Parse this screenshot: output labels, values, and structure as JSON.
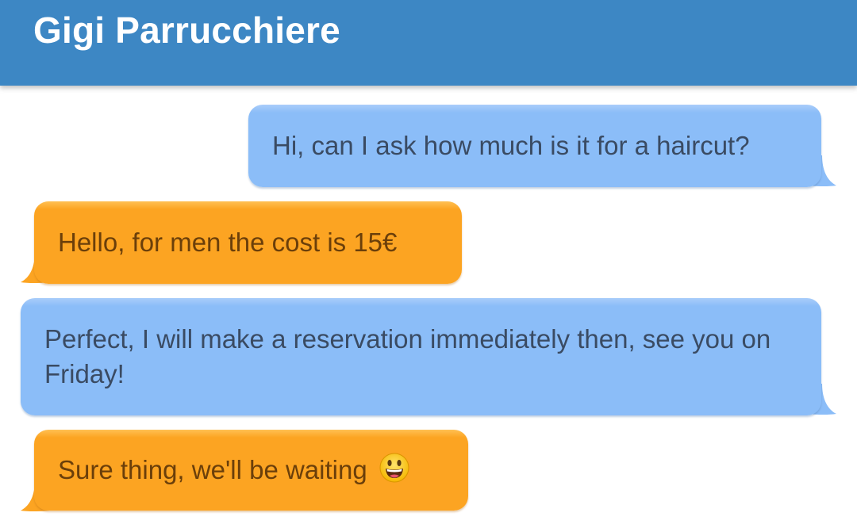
{
  "header": {
    "title": "Gigi Parrucchiere"
  },
  "messages": [
    {
      "direction": "outgoing",
      "text": "Hi, can I ask how much is it for a haircut?"
    },
    {
      "direction": "incoming",
      "text": "Hello, for men the cost is 15€"
    },
    {
      "direction": "outgoing",
      "text": "Perfect, I will make a reservation immediately then, see you on Friday!"
    },
    {
      "direction": "incoming",
      "text": "Sure thing, we'll be waiting",
      "emoji": "grinning-face-emoji"
    }
  ],
  "colors": {
    "header": "#3d87c4",
    "outgoing_bubble": "#8bbdf8",
    "incoming_bubble": "#fca422",
    "outgoing_text": "#3a4b63",
    "incoming_text": "#6b3f0a"
  }
}
